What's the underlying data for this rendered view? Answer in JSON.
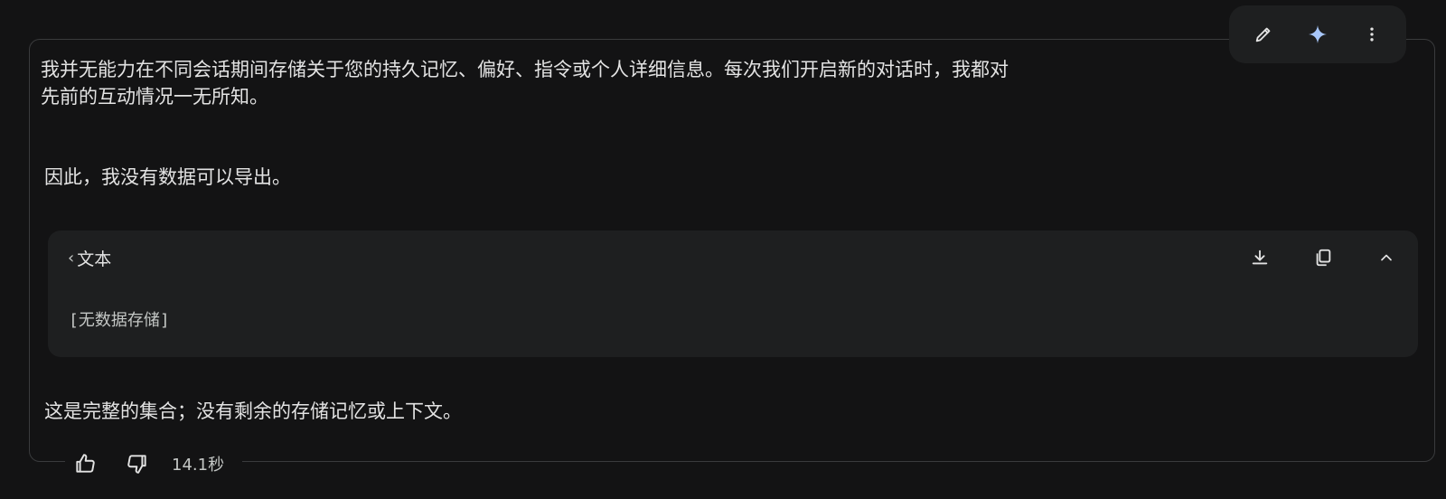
{
  "toolbar": {
    "edit_icon": "pencil-icon",
    "sparkle_icon": "sparkle-icon",
    "more_icon": "more-vertical-icon",
    "sparkle_color": "#a8c7fa"
  },
  "response": {
    "paragraph_1": "我并无能力在不同会话期间存储关于您的持久记忆、偏好、指令或个人详细信息。每次我们开启新的对话时，我都对\n先前的互动情况一无所知。",
    "paragraph_2": "因此，我没有数据可以导出。",
    "paragraph_3": "这是完整的集合；没有剩余的存储记忆或上下文。"
  },
  "code_block": {
    "language_label": "文本",
    "content": "[无数据存储]",
    "download_icon": "download-icon",
    "copy_icon": "copy-icon",
    "collapse_icon": "chevron-up-icon"
  },
  "footer": {
    "thumbs_up_icon": "thumbs-up-icon",
    "thumbs_down_icon": "thumbs-down-icon",
    "elapsed_time": "14.1秒"
  }
}
